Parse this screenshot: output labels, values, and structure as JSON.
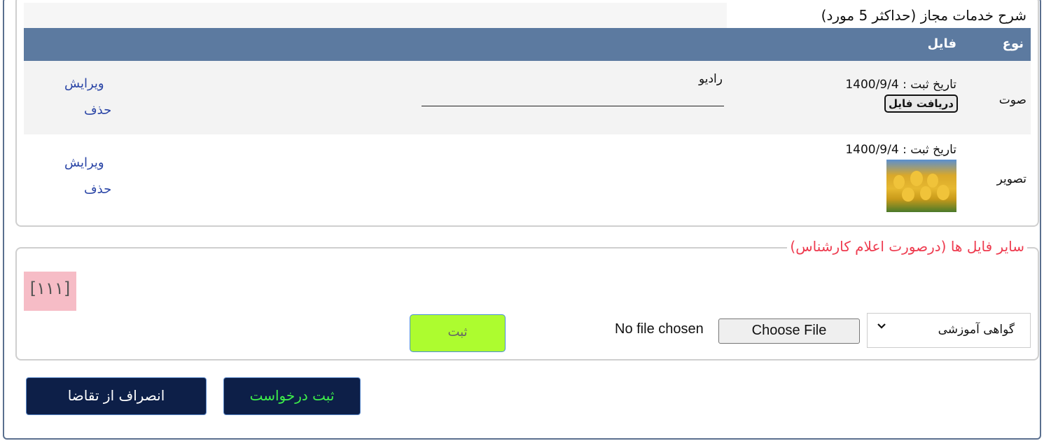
{
  "section": {
    "description_label": "شرح خدمات مجاز (حداکثر 5 مورد)"
  },
  "table": {
    "headers": {
      "type": "نوع",
      "file": "فایل"
    },
    "rows": [
      {
        "type": "صوت",
        "date": "تاریخ ثبت : 1400/9/4",
        "download": "دریافت فایل",
        "description": "رادیو",
        "edit": "ویرایش",
        "delete": "حذف"
      },
      {
        "type": "تصویر",
        "date": "تاریخ ثبت : 1400/9/4",
        "edit": "ویرایش",
        "delete": "حذف"
      }
    ]
  },
  "other_files": {
    "legend": "سایر فایل ها (درصورت اعلام کارشناس)",
    "tag": "[١١١]",
    "select_value": "گواهی آموزشی",
    "choose_file": "Choose File",
    "no_file": "No file chosen",
    "submit": "ثبت"
  },
  "actions": {
    "submit_request": "ثبت درخواست",
    "cancel_request": "انصراف از تقاضا"
  },
  "colors": {
    "header": "#5c7aa0",
    "legend": "#ee3b4f",
    "green_button": "#adfc2f",
    "navy_button": "#0d1f48",
    "green_text": "#3ef04a",
    "link": "#2a45a6"
  }
}
